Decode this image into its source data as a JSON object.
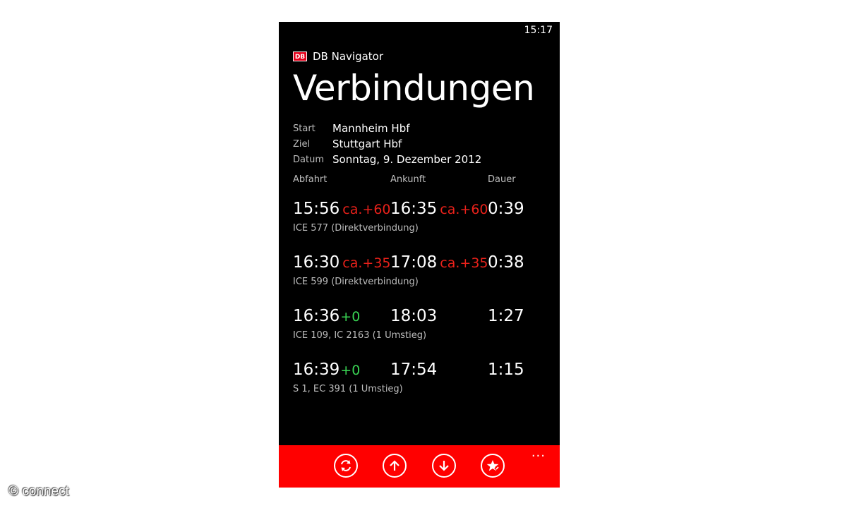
{
  "status_bar": {
    "time": "15:17"
  },
  "app": {
    "logo_text": "DB",
    "name": "DB Navigator"
  },
  "page": {
    "title": "Verbindungen"
  },
  "query": {
    "start_label": "Start",
    "start_value": "Mannheim Hbf",
    "ziel_label": "Ziel",
    "ziel_value": "Stuttgart Hbf",
    "datum_label": "Datum",
    "datum_value": "Sonntag, 9. Dezember 2012"
  },
  "columns": {
    "departure": "Abfahrt",
    "arrival": "Ankunft",
    "duration": "Dauer"
  },
  "connections": [
    {
      "dep_time": "15:56",
      "dep_delay": "ca.+60",
      "arr_time": "16:35",
      "arr_delay": "ca.+60",
      "duration": "0:39",
      "train": "ICE 577 (Direktverbindung)"
    },
    {
      "dep_time": "16:30",
      "dep_delay": "ca.+35",
      "arr_time": "17:08",
      "arr_delay": "ca.+35",
      "duration": "0:38",
      "train": "ICE 599 (Direktverbindung)"
    },
    {
      "dep_time": "16:36",
      "dep_delay": "+0",
      "arr_time": "18:03",
      "arr_delay": "",
      "duration": "1:27",
      "train": "ICE 109, IC 2163 (1 Umstieg)"
    },
    {
      "dep_time": "16:39",
      "dep_delay": "+0",
      "arr_time": "17:54",
      "arr_delay": "",
      "duration": "1:15",
      "train": "S 1, EC 391 (1 Umstieg)"
    }
  ],
  "app_bar": {
    "icons": [
      "refresh-icon",
      "arrow-up-icon",
      "arrow-down-icon",
      "favorite-star-icon"
    ],
    "more": "..."
  },
  "colors": {
    "accent_red": "#ff0000",
    "delay_red": "#e8211a",
    "ontime_green": "#39d353",
    "background": "#000000"
  },
  "watermark": "© connect"
}
